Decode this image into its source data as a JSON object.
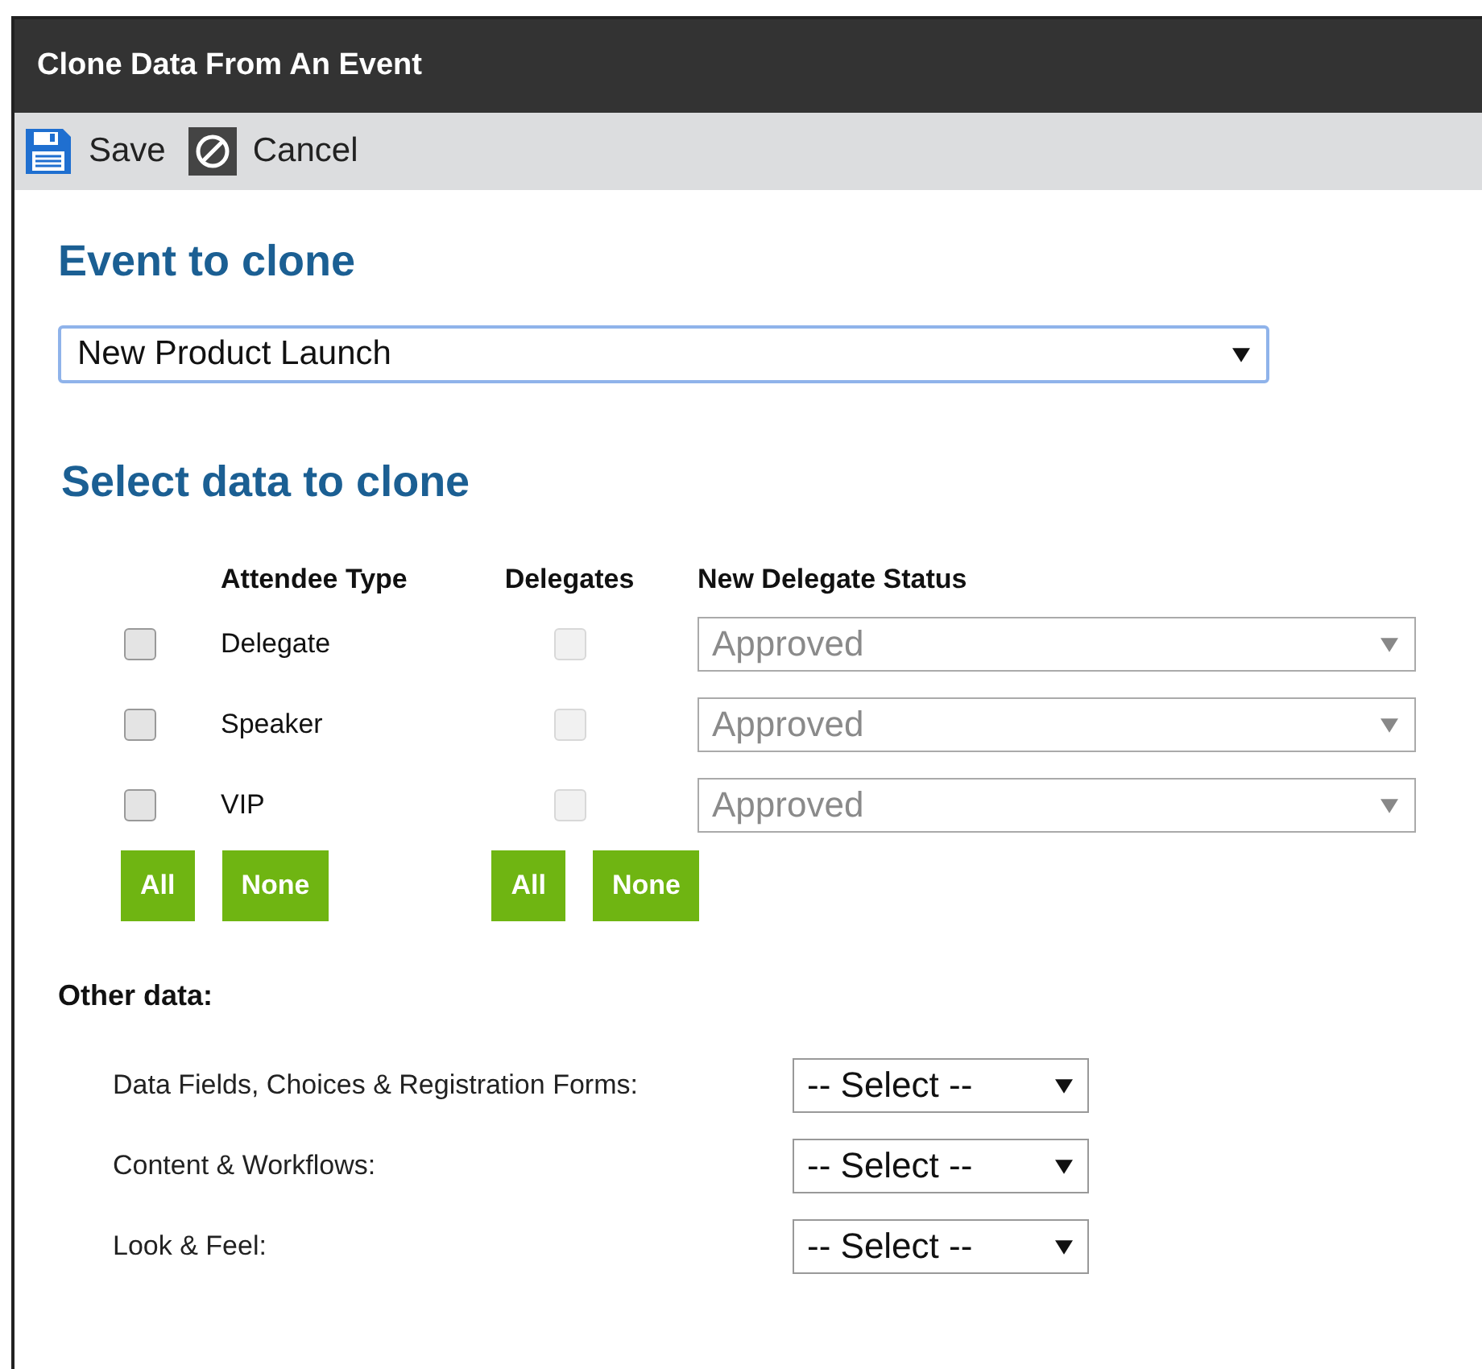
{
  "window": {
    "title": "Clone Data From An Event"
  },
  "toolbar": [
    {
      "kind": "save",
      "label": "Save"
    },
    {
      "kind": "cancel",
      "label": "Cancel"
    }
  ],
  "event_section": {
    "heading": "Event to clone",
    "event_select": {
      "value": "New Product Launch"
    }
  },
  "data_section": {
    "heading": "Select data to clone",
    "columns": [
      "Attendee Type",
      "Delegates",
      "New Delegate Status"
    ],
    "rows": [
      {
        "attendee_type": "Delegate",
        "checked": false,
        "delegates_checked": false,
        "delegates_disabled": true,
        "status": "Approved",
        "status_disabled": true
      },
      {
        "attendee_type": "Speaker",
        "checked": false,
        "delegates_checked": false,
        "delegates_disabled": true,
        "status": "Approved",
        "status_disabled": true
      },
      {
        "attendee_type": "VIP",
        "checked": false,
        "delegates_checked": false,
        "delegates_disabled": true,
        "status": "Approved",
        "status_disabled": true
      }
    ],
    "attendee_buttons": [
      "All",
      "None"
    ],
    "delegate_buttons": [
      "All",
      "None"
    ]
  },
  "other_data": {
    "heading": "Other data:",
    "items": [
      {
        "label": "Data Fields, Choices & Registration Forms:",
        "value": "-- Select --"
      },
      {
        "label": "Content & Workflows:",
        "value": "-- Select --"
      },
      {
        "label": "Look & Feel:",
        "value": "-- Select --"
      }
    ]
  }
}
